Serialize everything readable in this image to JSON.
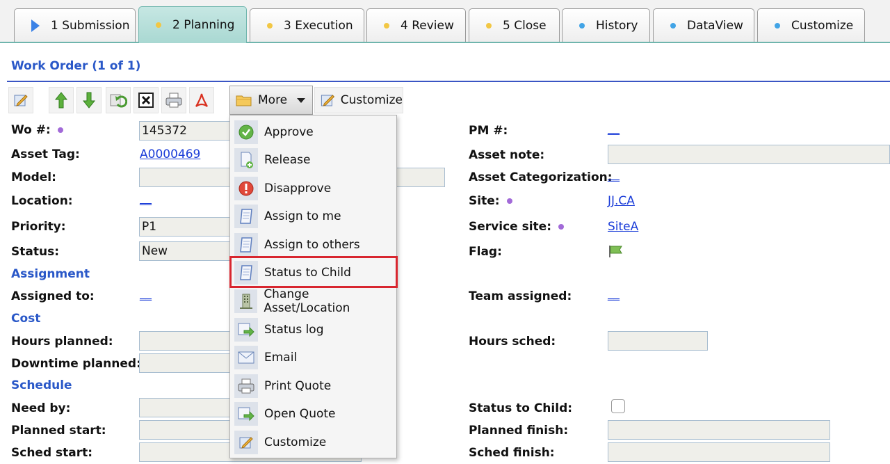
{
  "tabs": [
    {
      "label": "1 Submission",
      "marker": "triangle",
      "active": false
    },
    {
      "label": "2 Planning",
      "marker": "dot",
      "dot_color": "#f2c744",
      "active": true
    },
    {
      "label": "3 Execution",
      "marker": "dot",
      "dot_color": "#f2c744",
      "active": false
    },
    {
      "label": "4 Review",
      "marker": "dot",
      "dot_color": "#f2c744",
      "active": false
    },
    {
      "label": "5 Close",
      "marker": "dot",
      "dot_color": "#f2c744",
      "active": false
    },
    {
      "label": "History",
      "marker": "dot",
      "dot_color": "#42a4e6",
      "active": false
    },
    {
      "label": "DataView",
      "marker": "dot",
      "dot_color": "#42a4e6",
      "active": false
    },
    {
      "label": "Customize",
      "marker": "dot",
      "dot_color": "#42a4e6",
      "active": false
    }
  ],
  "header": {
    "title": "Work Order (1 of 1)"
  },
  "toolbar": {
    "icons": [
      "edit-icon",
      "arrow-up-icon",
      "arrow-down-icon",
      "refresh-icon",
      "close-icon",
      "printer-icon",
      "pdf-icon"
    ],
    "more_label": "More",
    "customize_label": "Customize"
  },
  "form": {
    "wo_label": "Wo #:",
    "wo_value": "145372",
    "asset_tag_label": "Asset Tag:",
    "asset_tag_value": "A0000469",
    "model_label": "Model:",
    "location_label": "Location:",
    "location_value": "__",
    "priority_label": "Priority:",
    "priority_value": "P1",
    "status_label": "Status:",
    "status_value": "New",
    "assignment_section": "Assignment",
    "assigned_to_label": "Assigned to:",
    "assigned_to_value": "__",
    "cost_section": "Cost",
    "hours_planned_label": "Hours planned:",
    "downtime_planned_label": "Downtime planned:",
    "schedule_section": "Schedule",
    "need_by_label": "Need by:",
    "planned_start_label": "Planned start:",
    "sched_start_label": "Sched start:",
    "pm_label": "PM #:",
    "pm_value": "__",
    "asset_note_label": "Asset note:",
    "asset_cat_label": "Asset Categorization:",
    "asset_cat_value": "__",
    "site_label": "Site:",
    "site_value": "JJ.CA",
    "service_site_label": "Service site:",
    "service_site_value": "SiteA",
    "flag_label": "Flag:",
    "team_assigned_label": "Team assigned:",
    "team_assigned_value": "__",
    "hours_sched_label": "Hours sched:",
    "status_to_child_label": "Status to Child:",
    "status_to_child_checked": false,
    "planned_finish_label": "Planned finish:",
    "sched_finish_label": "Sched finish:"
  },
  "menu": {
    "items": [
      {
        "label": "Approve",
        "icon": "check-circle-icon"
      },
      {
        "label": "Release",
        "icon": "document-plus-icon"
      },
      {
        "label": "Disapprove",
        "icon": "alert-circle-icon"
      },
      {
        "label": "Assign to me",
        "icon": "scroll-icon"
      },
      {
        "label": "Assign to others",
        "icon": "scroll-icon"
      },
      {
        "label": "Status to Child",
        "icon": "scroll-icon",
        "highlighted": true
      },
      {
        "label": "Change Asset/Location",
        "icon": "building-icon"
      },
      {
        "label": "Status log",
        "icon": "arrow-right-icon"
      },
      {
        "label": "Email",
        "icon": "envelope-icon"
      },
      {
        "label": "Print Quote",
        "icon": "printer-icon"
      },
      {
        "label": "Open Quote",
        "icon": "arrow-right-icon"
      },
      {
        "label": "Customize",
        "icon": "edit-icon"
      }
    ],
    "highlight_color": "#d8262f"
  }
}
